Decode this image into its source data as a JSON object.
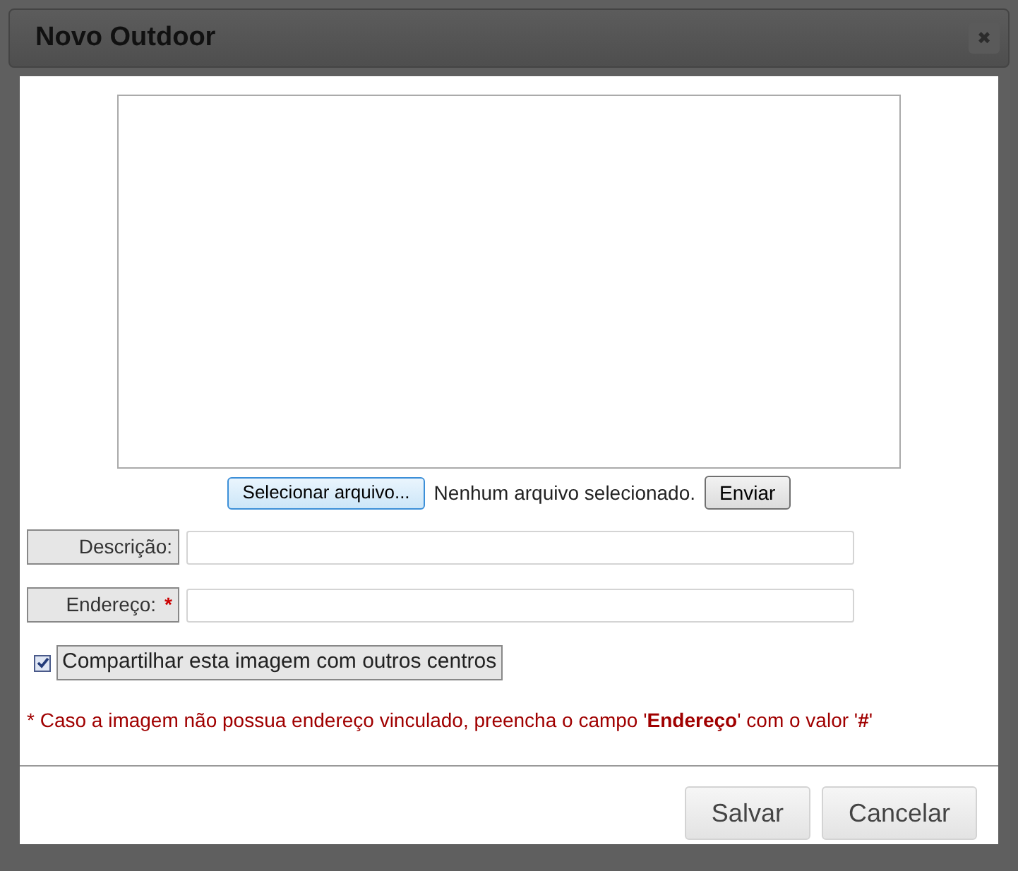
{
  "dialog": {
    "title": "Novo Outdoor",
    "close_icon": "✖"
  },
  "upload": {
    "select_button": "Selecionar arquivo...",
    "file_status": "Nenhum arquivo selecionado.",
    "send_button": "Enviar"
  },
  "fields": [
    {
      "label": "Descrição:"
    },
    {
      "label": "Endereço:",
      "required_mark": "*"
    }
  ],
  "share": {
    "label": "Compartilhar esta imagem com outros centros",
    "checked": true
  },
  "note": "* Caso a imagem não possua endereço vinculado, preencha o campo '**Endereço**' com o valor '**#**'",
  "buttons": [
    "Salvar",
    "Cancelar"
  ]
}
